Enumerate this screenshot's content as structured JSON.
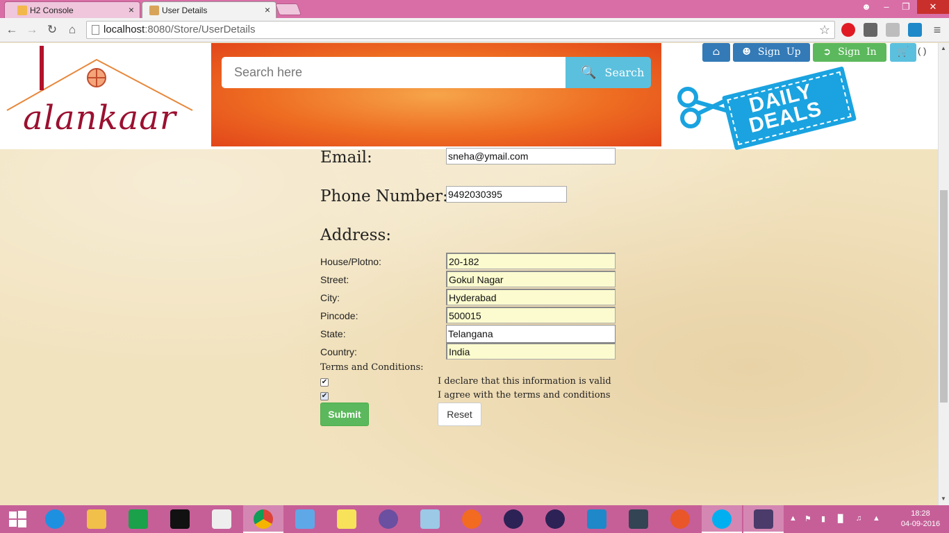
{
  "browser": {
    "tabs": [
      {
        "label": "H2 Console",
        "close": "×"
      },
      {
        "label": "User Details",
        "close": "×"
      }
    ],
    "url_host": "localhost",
    "url_rest": ":8080/Store/UserDetails",
    "window_controls": {
      "minimize": "–",
      "maximize": "❐",
      "close": "✕"
    }
  },
  "header": {
    "logo_text": "alankaar",
    "search_placeholder": "Search here",
    "search_button": "Search",
    "home_icon": "home-icon",
    "signup_label": "Sign  Up",
    "signin_label": "Sign  In",
    "cart_count": "( )",
    "deals_line1": "DAILY",
    "deals_line2": "DEALS"
  },
  "form": {
    "email_label": "Email:",
    "email_value": "sneha@ymail.com",
    "phone_label": "Phone Number:",
    "phone_value": "9492030395",
    "address_label": "Address:",
    "house_label": "House/Plotno:",
    "house_value": "20-182",
    "street_label": "Street:",
    "street_value": "Gokul Nagar",
    "city_label": "City:",
    "city_value": "Hyderabad",
    "pincode_label": "Pincode:",
    "pincode_value": "500015",
    "state_label": "State:",
    "state_value": "Telangana",
    "country_label": "Country:",
    "country_value": "India",
    "terms_label": "Terms and Conditions:",
    "declare_label": "I declare that this information is valid",
    "agree_label": "I agree with the terms and conditions",
    "declare_checked": true,
    "agree_checked": true,
    "submit_label": "Submit",
    "reset_label": "Reset"
  },
  "taskbar": {
    "time": "18:28",
    "date": "04-09-2016"
  },
  "colors": {
    "primary": "#337ab7",
    "success": "#5cb85c",
    "info": "#5bc0de",
    "brand": "#9b1030",
    "tabbar": "#d96ea7",
    "taskbar": "#c65f98"
  }
}
